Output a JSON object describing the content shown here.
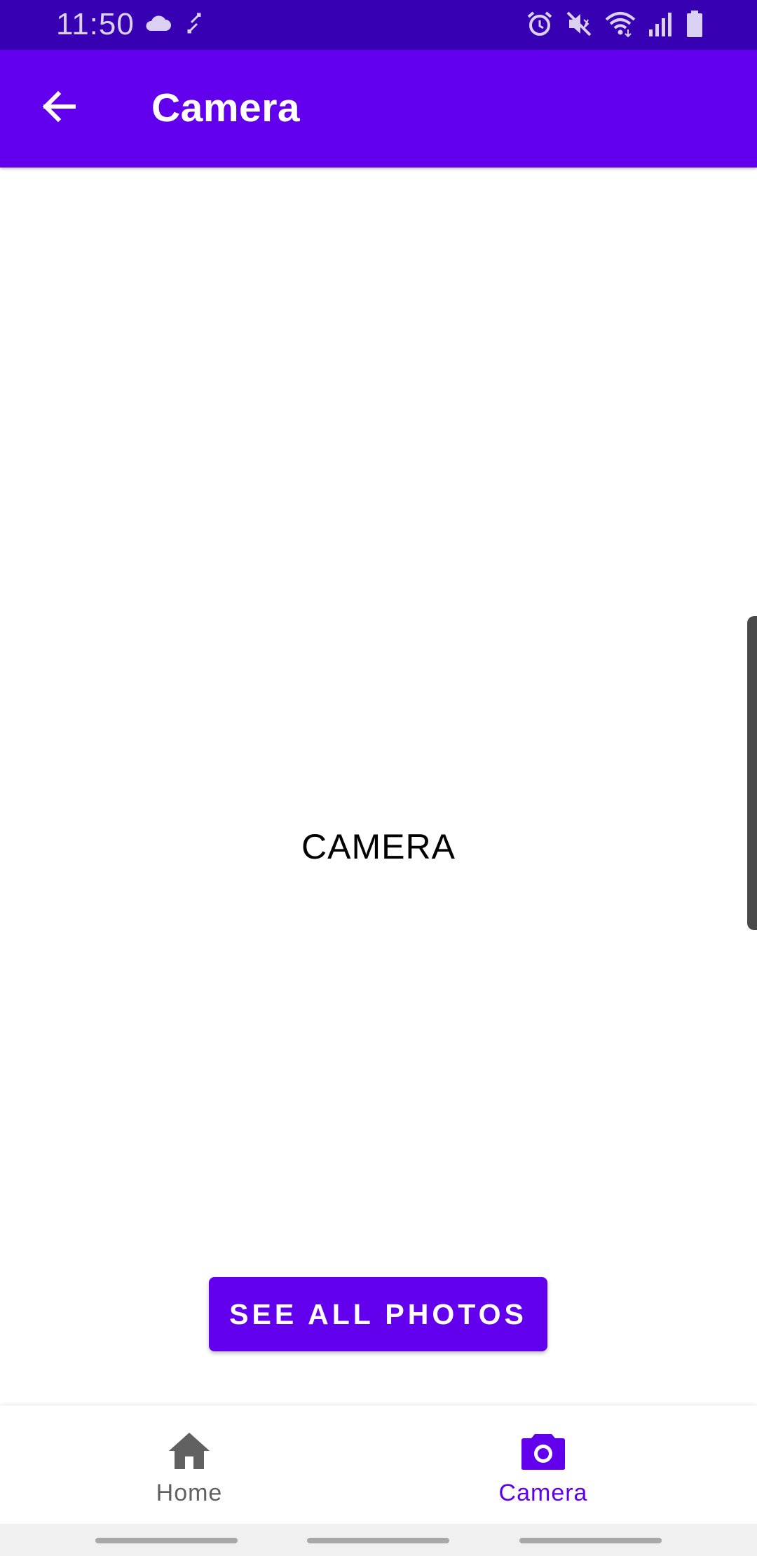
{
  "status_bar": {
    "time": "11:50",
    "left_icons": [
      "cloud-icon",
      "sync-arrows-icon"
    ],
    "right_icons": [
      "alarm-icon",
      "mute-icon",
      "wifi-icon",
      "signal-icon",
      "battery-icon"
    ]
  },
  "app_bar": {
    "title": "Camera",
    "back_icon": "arrow-back-icon",
    "background": "#6200EE"
  },
  "main": {
    "center_label": "CAMERA"
  },
  "action": {
    "see_all_label": "SEE ALL PHOTOS"
  },
  "bottom_nav": {
    "items": [
      {
        "label": "Home",
        "icon": "home-icon",
        "selected": false
      },
      {
        "label": "Camera",
        "icon": "camera-icon",
        "selected": true
      }
    ],
    "selected_color": "#6200EE",
    "unselected_color": "#616161"
  },
  "colors": {
    "status_bar": "#3700B3",
    "primary": "#6200EE"
  }
}
